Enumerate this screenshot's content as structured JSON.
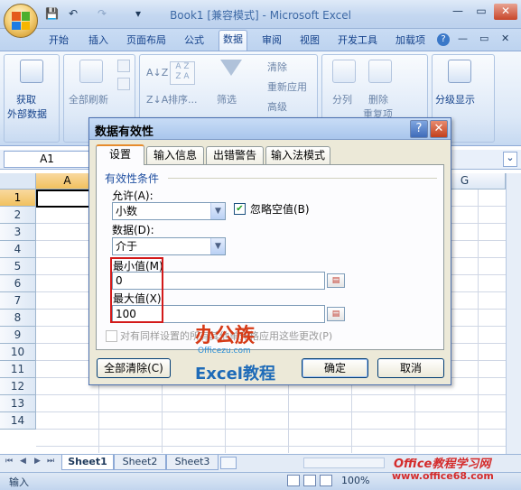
{
  "window": {
    "title": "Book1 [兼容模式] - Microsoft Excel",
    "quick_access": {
      "save": "💾",
      "undo": "↶",
      "redo": "↷",
      "customize": "▾"
    },
    "controls": {
      "minimize": "—",
      "restore": "▭",
      "close": "✕"
    },
    "ribbon_controls": {
      "minimize": "—",
      "restore": "▭",
      "close": "✕"
    }
  },
  "tabs": [
    "开始",
    "插入",
    "页面布局",
    "公式",
    "数据",
    "审阅",
    "视图",
    "开发工具",
    "加载项"
  ],
  "active_tab": "数据",
  "help_icon": "?",
  "ribbon": {
    "get_external_data": {
      "line1": "获取",
      "line2": "外部数据"
    },
    "refresh_all": "全部刷新",
    "sort": "排序...",
    "filter": "筛选",
    "clear": "清除",
    "reapply": "重新应用",
    "advanced": "高级",
    "text_to_columns": "分列",
    "remove_duplicates": {
      "line1": "删除",
      "line2": "重复项"
    },
    "outline": "分级显示",
    "sort_az": "A↓Z",
    "sort_za": "Z↓A",
    "sort_icon_top": "A Z",
    "sort_icon_bottom": "Z A"
  },
  "formula_bar": {
    "name_box": "A1",
    "expand": "⌄"
  },
  "grid": {
    "columns": [
      "A",
      "G"
    ],
    "rows": [
      "1",
      "2",
      "3",
      "4",
      "5",
      "6",
      "7",
      "8",
      "9",
      "10",
      "11",
      "12",
      "13",
      "14"
    ]
  },
  "sheets": [
    "Sheet1",
    "Sheet2",
    "Sheet3"
  ],
  "sheet_nav": [
    "⏮",
    "◀",
    "▶",
    "⏭"
  ],
  "status": {
    "mode": "输入",
    "zoom": "100%"
  },
  "dialog": {
    "title": "数据有效性",
    "help": "?",
    "close": "✕",
    "tabs": [
      "设置",
      "输入信息",
      "出错警告",
      "输入法模式"
    ],
    "active_tab": "设置",
    "section": "有效性条件",
    "allow_label": "允许(A):",
    "allow_value": "小数",
    "ignore_blank": "忽略空值(B)",
    "data_label": "数据(D):",
    "data_value": "介于",
    "min_label": "最小值(M)",
    "min_value": "0",
    "max_label": "最大值(X)",
    "max_value": "100",
    "apply_all": "对有同样设置的所有其他单元格应用这些更改(P)",
    "clear_all": "全部清除(C)",
    "ok": "确定",
    "cancel": "取消"
  },
  "watermarks": {
    "brand_cn": "办公族",
    "brand_url": "Officezu.com",
    "brand_sub": "Excel教程",
    "site_name": "Office教程学习网",
    "site_url": "www.office68.com"
  },
  "colors": {
    "accent": "#e68b2c",
    "highlight": "#d31a1a",
    "title_blue": "#15428b"
  }
}
